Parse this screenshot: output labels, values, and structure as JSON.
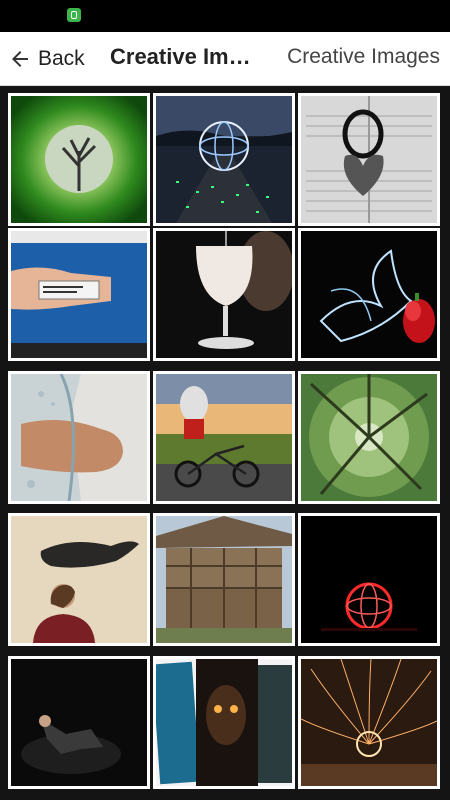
{
  "toolbar": {
    "back_label": "Back",
    "title": "Creative Ima…",
    "subtitle": "Creative Images"
  },
  "colors": {
    "toolbar_bg": "#ffffff",
    "grid_bg": "#141414",
    "status_icon": "#3cb64a"
  },
  "status_bar": {
    "icon": "android-notification-icon"
  },
  "gallery": {
    "rows": 5,
    "columns": 3
  }
}
